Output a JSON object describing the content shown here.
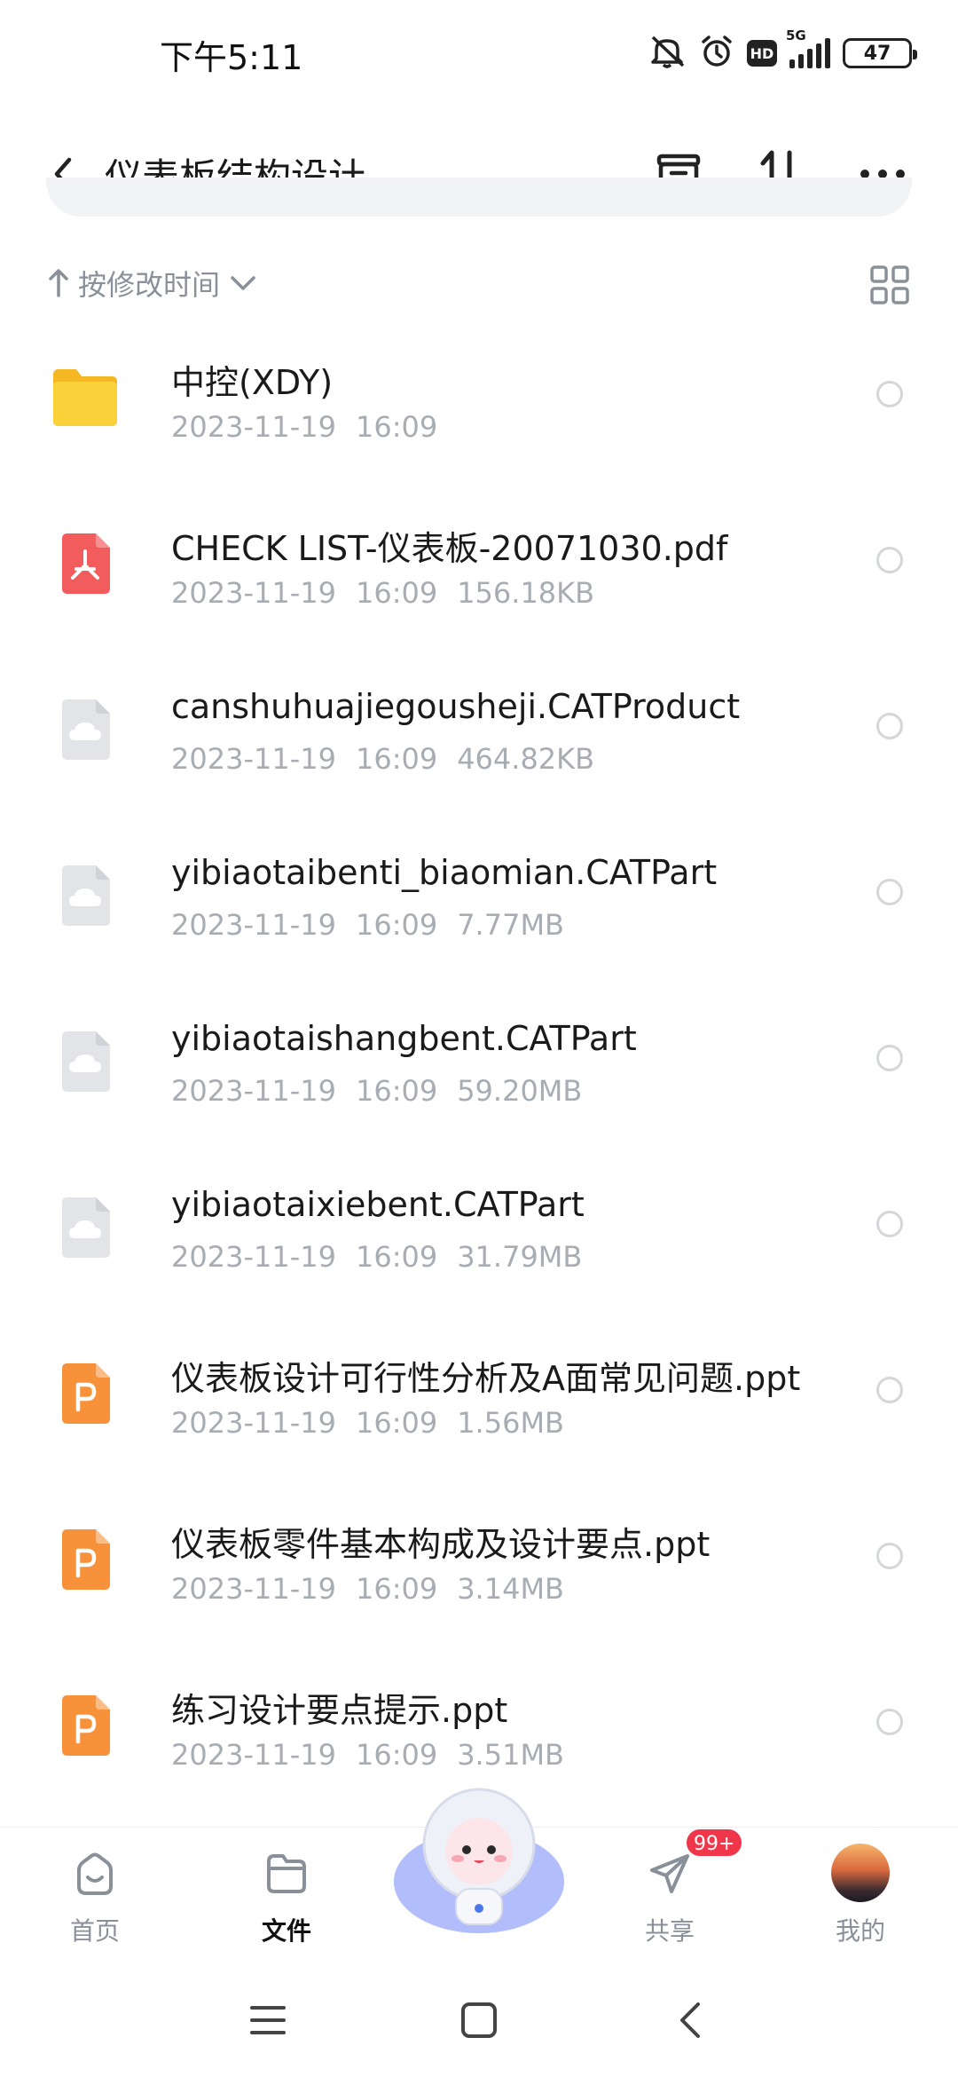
{
  "status_bar": {
    "time": "下午5:11",
    "network": "5G",
    "hd": "HD",
    "battery": "47"
  },
  "header": {
    "title": "仪表板结构设计",
    "icons": [
      "back-arrow-icon",
      "archive-icon",
      "sort-arrows-icon",
      "more-icon"
    ]
  },
  "sort": {
    "label": "按修改时间",
    "view_mode_icon": "grid-view-icon"
  },
  "files": [
    {
      "name": "中控(XDY)",
      "date": "2023-11-19",
      "time": "16:09",
      "size": "",
      "type": "folder"
    },
    {
      "name": "CHECK LIST-仪表板-20071030.pdf",
      "date": "2023-11-19",
      "time": "16:09",
      "size": "156.18KB",
      "type": "pdf"
    },
    {
      "name": "canshuhuajiegousheji.CATProduct",
      "date": "2023-11-19",
      "time": "16:09",
      "size": "464.82KB",
      "type": "unknown"
    },
    {
      "name": "yibiaotaibenti_biaomian.CATPart",
      "date": "2023-11-19",
      "time": "16:09",
      "size": "7.77MB",
      "type": "unknown"
    },
    {
      "name": "yibiaotaishangbent.CATPart",
      "date": "2023-11-19",
      "time": "16:09",
      "size": "59.20MB",
      "type": "unknown"
    },
    {
      "name": "yibiaotaixiebent.CATPart",
      "date": "2023-11-19",
      "time": "16:09",
      "size": "31.79MB",
      "type": "unknown"
    },
    {
      "name": "仪表板设计可行性分析及A面常见问题.ppt",
      "date": "2023-11-19",
      "time": "16:09",
      "size": "1.56MB",
      "type": "ppt"
    },
    {
      "name": "仪表板零件基本构成及设计要点.ppt",
      "date": "2023-11-19",
      "time": "16:09",
      "size": "3.14MB",
      "type": "ppt"
    },
    {
      "name": "练习设计要点提示.ppt",
      "date": "2023-11-19",
      "time": "16:09",
      "size": "3.51MB",
      "type": "ppt"
    }
  ],
  "bottom_nav": {
    "items": [
      {
        "label": "首页",
        "icon": "home-icon",
        "active": false
      },
      {
        "label": "文件",
        "icon": "folder-icon",
        "active": true
      },
      {
        "label": "共享",
        "icon": "send-icon",
        "active": false,
        "badge": "99+"
      },
      {
        "label": "我的",
        "icon": "avatar",
        "active": false
      }
    ]
  },
  "colors": {
    "folder": "#f7c531",
    "pdf": "#f25c5c",
    "ppt": "#f7913a",
    "generic": "#e4e6ea",
    "badge": "#f0364a",
    "meta_text": "#a8adb4"
  }
}
